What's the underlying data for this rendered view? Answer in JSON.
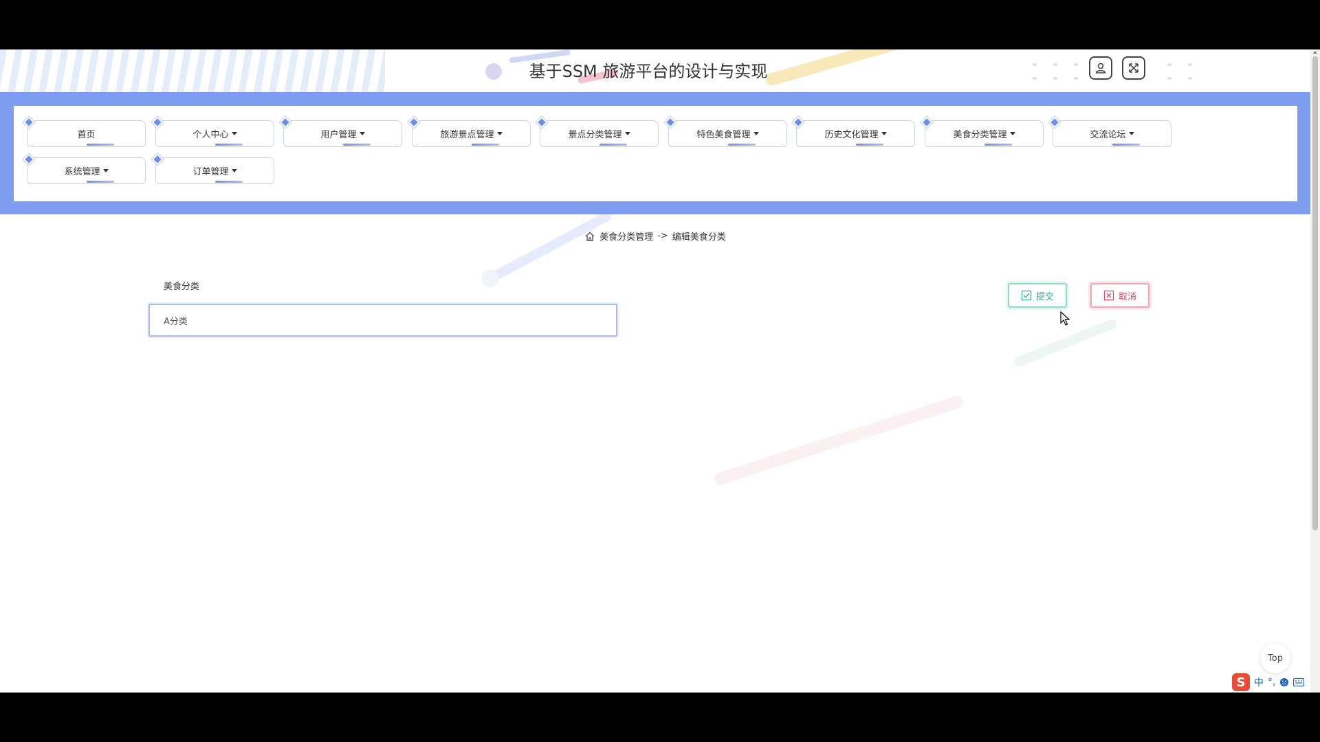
{
  "header": {
    "title": "基于SSM 旅游平台的设计与实现"
  },
  "nav": {
    "row1": [
      {
        "label": "首页",
        "dropdown": false
      },
      {
        "label": "个人中心",
        "dropdown": true
      },
      {
        "label": "用户管理",
        "dropdown": true
      },
      {
        "label": "旅游景点管理",
        "dropdown": true
      },
      {
        "label": "景点分类管理",
        "dropdown": true
      },
      {
        "label": "特色美食管理",
        "dropdown": true
      },
      {
        "label": "历史文化管理",
        "dropdown": true
      },
      {
        "label": "美食分类管理",
        "dropdown": true
      },
      {
        "label": "交流论坛",
        "dropdown": true
      }
    ],
    "row2": [
      {
        "label": "系统管理",
        "dropdown": true
      },
      {
        "label": "订单管理",
        "dropdown": true
      }
    ]
  },
  "breadcrumb": {
    "parent": "美食分类管理",
    "separator": "->",
    "current": "编辑美食分类"
  },
  "form": {
    "field_label": "美食分类",
    "field_value": "A分类"
  },
  "actions": {
    "submit_label": "提交",
    "cancel_label": "取消"
  },
  "top_button": "Top",
  "ime": {
    "mode": "中",
    "punct": "°,"
  },
  "colors": {
    "nav_band": "#7f9ef3",
    "submit": "#2bb59a",
    "cancel": "#e04a64"
  }
}
